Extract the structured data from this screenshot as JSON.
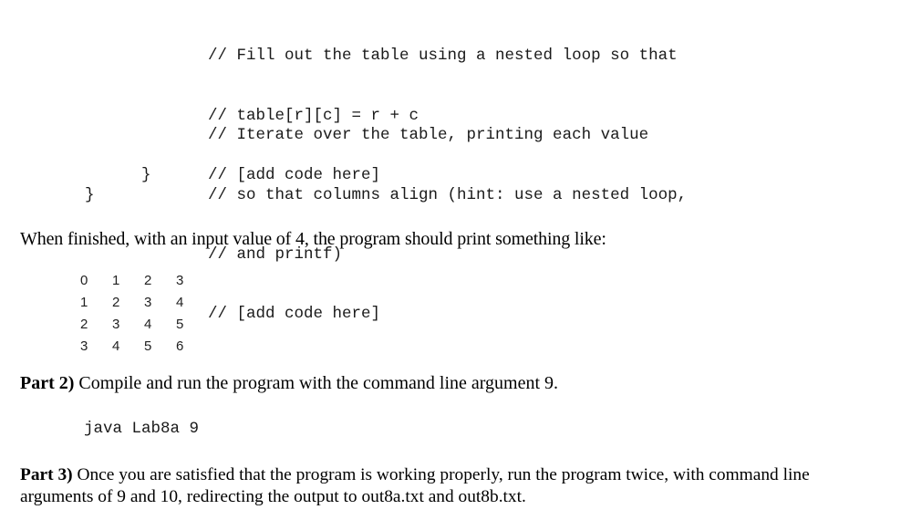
{
  "code": {
    "block1": [
      "// Fill out the table using a nested loop so that",
      "// table[r][c] = r + c",
      "// [add code here]"
    ],
    "block2": [
      "// Iterate over the table, printing each value",
      "// so that columns align (hint: use a nested loop,",
      "// and printf)",
      "// [add code here]"
    ],
    "inner_brace": "}",
    "outer_brace": "}"
  },
  "intro_text": "When finished, with an input value of 4, the program should print something like:",
  "sample_output": [
    [
      "0",
      "1",
      "2",
      "3"
    ],
    [
      "1",
      "2",
      "3",
      "4"
    ],
    [
      "2",
      "3",
      "4",
      "5"
    ],
    [
      "3",
      "4",
      "5",
      "6"
    ]
  ],
  "part2": {
    "label": "Part 2)",
    "text": " Compile and run the program with the command line argument 9.",
    "command": "java Lab8a 9"
  },
  "part3": {
    "label": "Part 3)",
    "text": " Once you are satisfied that the program is working properly, run the program twice, with command line arguments of 9 and 10, redirecting the output to out8a.txt and out8b.txt."
  }
}
